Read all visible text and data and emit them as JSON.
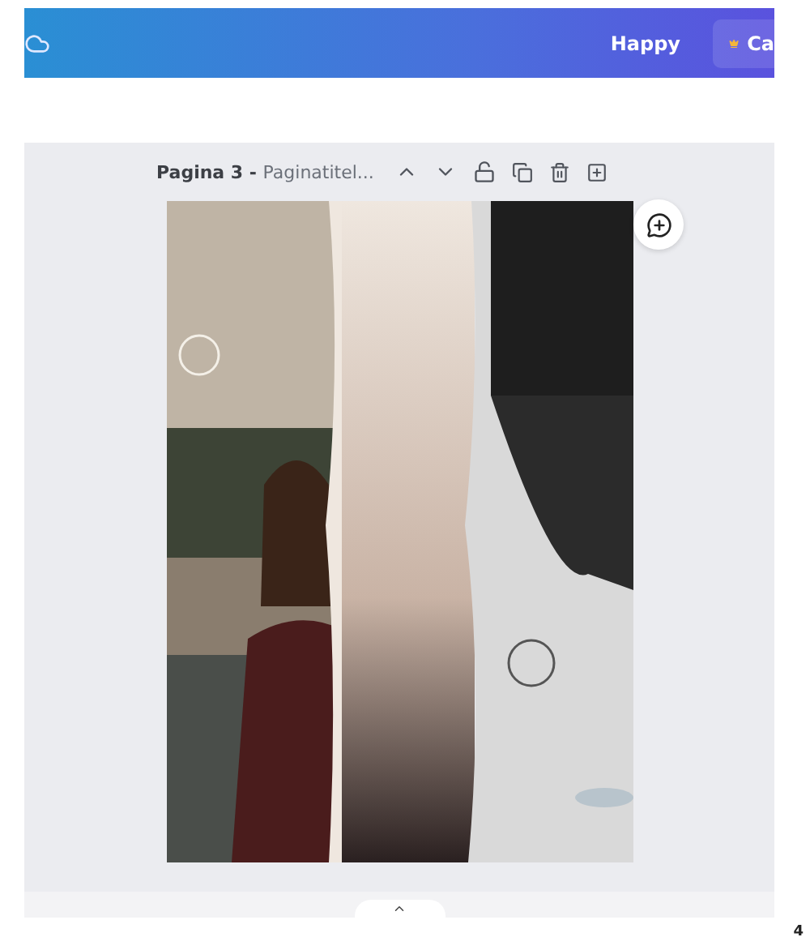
{
  "top_bar": {
    "user_name": "Happy",
    "upgrade_button": "Ca"
  },
  "page_header": {
    "page_label": "Pagina 3 - ",
    "page_title": "Paginatitel..."
  },
  "footer": {
    "page_number": "4"
  }
}
